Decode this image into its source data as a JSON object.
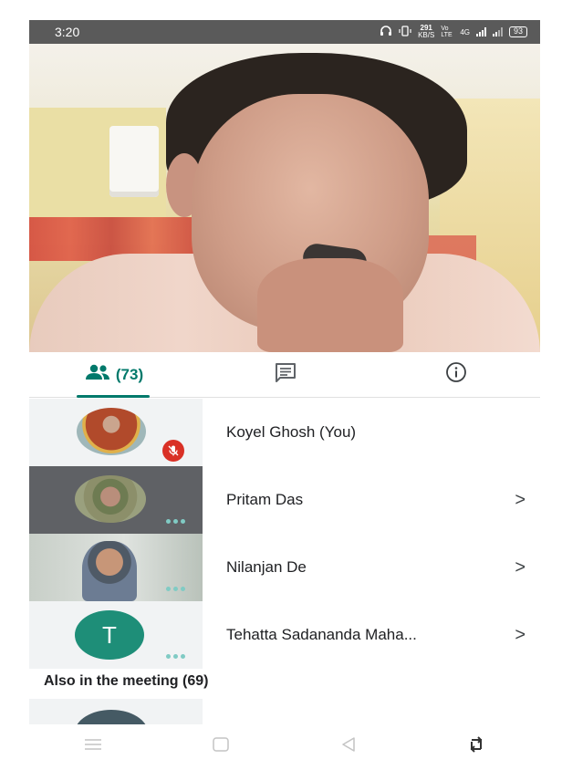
{
  "status_bar": {
    "time": "3:20",
    "speed_value": "291",
    "speed_unit": "KB/S",
    "volte": "Vo LTE",
    "network": "4G",
    "battery": "93"
  },
  "tabs": {
    "people_count": "(73)"
  },
  "participants": [
    {
      "name": "Koyel Ghosh (You)",
      "muted": true
    },
    {
      "name": "Pritam Das"
    },
    {
      "name": "Nilanjan De"
    },
    {
      "name": "Tehatta Sadananda Maha...",
      "initial": "T"
    }
  ],
  "section": {
    "also_in_meeting": "Also in the meeting (69)"
  },
  "colors": {
    "accent": "#00796b",
    "mute": "#d93025",
    "status_bar": "#5a5a5a",
    "avatar_teal": "#1e8e78"
  }
}
